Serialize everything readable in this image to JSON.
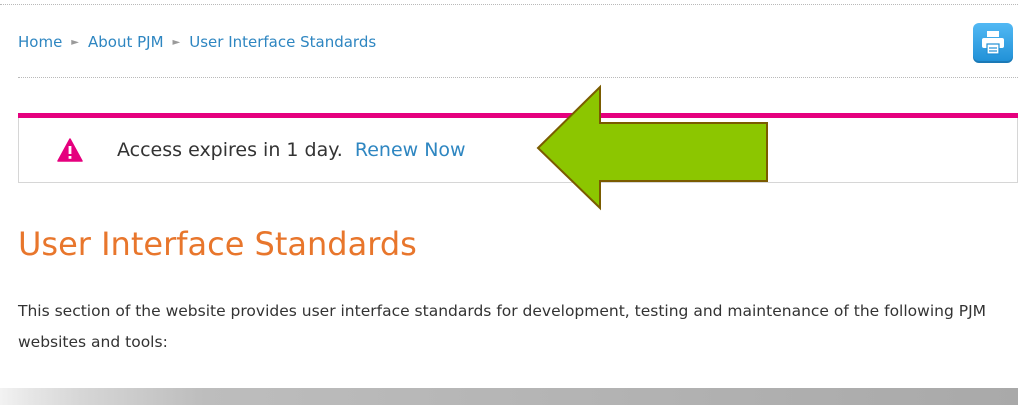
{
  "breadcrumb": {
    "items": [
      {
        "label": "Home"
      },
      {
        "label": "About PJM"
      },
      {
        "label": "User Interface Standards"
      }
    ],
    "separator_icon": "triangle-right-icon"
  },
  "toolbar": {
    "print_icon": "printer-icon",
    "print_color": "#2e95e0"
  },
  "alert": {
    "icon": "warning-triangle-icon",
    "accent_color": "#e5007e",
    "message": "Access expires in 1 day.",
    "link_label": "Renew Now",
    "callout_icon": "arrow-left-icon",
    "callout_color": "#8cc600"
  },
  "main": {
    "title": "User Interface Standards",
    "title_color": "#e8762c",
    "intro": "This section of the website provides user interface standards for development, testing and maintenance of the following PJM websites and tools:"
  }
}
